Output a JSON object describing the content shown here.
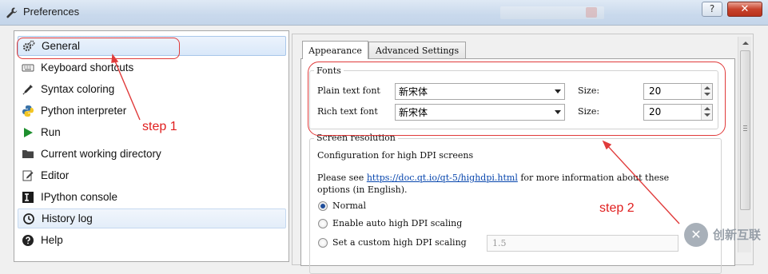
{
  "window": {
    "title": "Preferences",
    "help_label": "?",
    "close_label": "✕"
  },
  "sidebar": {
    "items": [
      {
        "label": "General",
        "icon": "gears-icon",
        "selected": true
      },
      {
        "label": "Keyboard shortcuts",
        "icon": "keyboard-icon"
      },
      {
        "label": "Syntax coloring",
        "icon": "eyedropper-icon"
      },
      {
        "label": "Python interpreter",
        "icon": "python-icon"
      },
      {
        "label": "Run",
        "icon": "play-icon"
      },
      {
        "label": "Current working directory",
        "icon": "folder-icon"
      },
      {
        "label": "Editor",
        "icon": "edit-icon"
      },
      {
        "label": "IPython console",
        "icon": "console-icon"
      },
      {
        "label": "History log",
        "icon": "history-icon"
      },
      {
        "label": "Help",
        "icon": "help-icon"
      }
    ]
  },
  "tabs": {
    "appearance": "Appearance",
    "advanced": "Advanced Settings"
  },
  "fonts": {
    "title": "Fonts",
    "plain_label": "Plain text font",
    "plain_value": "新宋体",
    "plain_size_label": "Size:",
    "plain_size": "20",
    "rich_label": "Rich text font",
    "rich_value": "新宋体",
    "rich_size_label": "Size:",
    "rich_size": "20"
  },
  "screen_resolution": {
    "title": "Screen resolution",
    "config_text": "Configuration for high DPI screens",
    "please_see": "Please see",
    "link": "https://doc.qt.io/qt-5/highdpi.html",
    "more_info": "for more information about these",
    "in_english": "options (in English).",
    "options": [
      {
        "label": "Normal",
        "checked": true
      },
      {
        "label": "Enable auto high DPI scaling",
        "checked": false
      },
      {
        "label": "Set a custom high DPI scaling",
        "checked": false
      }
    ],
    "custom_value": "1.5"
  },
  "annotations": {
    "step1": "step 1",
    "step2": "step 2",
    "color": "#e01e1e"
  },
  "watermark": {
    "text": "创新互联"
  }
}
